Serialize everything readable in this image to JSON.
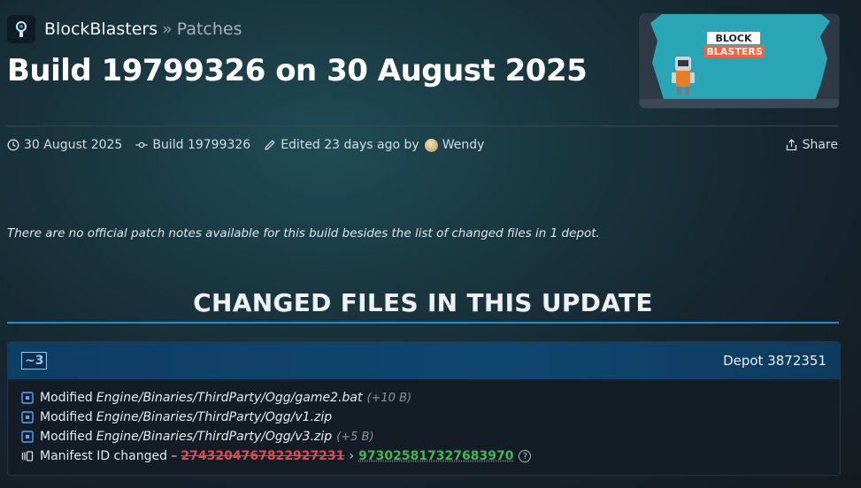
{
  "breadcrumb": {
    "app": "BlockBlasters",
    "separator": "»",
    "page": "Patches"
  },
  "page_title": "Build 19799326 on 30 August 2025",
  "thumbnail": {
    "logo_line1": "BLOCK",
    "logo_line2": "BLASTERS"
  },
  "meta": {
    "date": "30 August 2025",
    "build": "Build 19799326",
    "edited": "Edited 23 days ago by",
    "author": "Wendy",
    "share": "Share"
  },
  "note": "There are no official patch notes available for this build besides the list of changed files in 1 depot.",
  "section_title": "CHANGED FILES IN THIS UPDATE",
  "depot": {
    "badge": "~3",
    "name": "Depot 3872351",
    "files": [
      {
        "action": "Modified",
        "path": "Engine/Binaries/ThirdParty/Ogg/game2.bat",
        "delta": "(+10 B)"
      },
      {
        "action": "Modified",
        "path": "Engine/Binaries/ThirdParty/Ogg/v1.zip",
        "delta": ""
      },
      {
        "action": "Modified",
        "path": "Engine/Binaries/ThirdParty/Ogg/v3.zip",
        "delta": "(+5 B)"
      }
    ],
    "manifest": {
      "label": "Manifest ID changed –",
      "old_id": "2743204767822927231",
      "arrow": "›",
      "new_id": "973025817327683970",
      "help": "?"
    }
  },
  "colors": {
    "accent": "#1e8fd0",
    "removed": "#e5484d",
    "added": "#3fb950"
  }
}
